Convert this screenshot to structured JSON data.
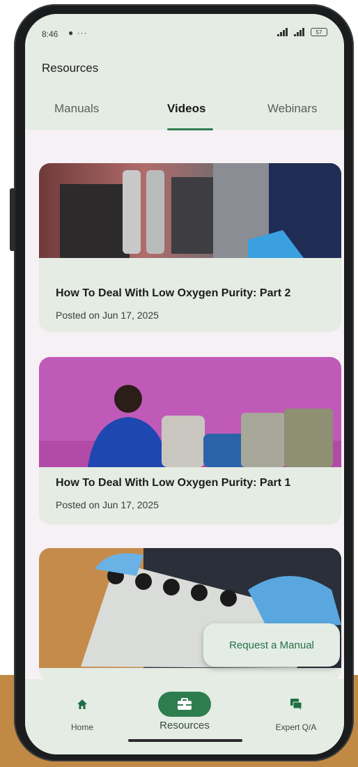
{
  "status_bar": {
    "time": "8:46",
    "battery": "57"
  },
  "header": {
    "title": "Resources"
  },
  "tabs": [
    {
      "label": "Manuals"
    },
    {
      "label": "Videos"
    },
    {
      "label": "Webinars"
    }
  ],
  "active_tab": "Videos",
  "videos": [
    {
      "title": "How To Deal With Low Oxygen Purity: Part 2",
      "date": "Posted on Jun 17, 2025"
    },
    {
      "title": "How To Deal With Low Oxygen Purity: Part 1",
      "date": "Posted on Jun 17, 2025"
    },
    {
      "title": "",
      "date": ""
    }
  ],
  "fab": {
    "label": "Request a Manual"
  },
  "bottom_nav": [
    {
      "label": "Home",
      "icon": "home-icon"
    },
    {
      "label": "Resources",
      "icon": "briefcase-icon"
    },
    {
      "label": "Expert Q/A",
      "icon": "chat-icon"
    }
  ],
  "colors": {
    "accent": "#2e7d4f",
    "surface": "#e4ece4",
    "background": "#f6f1f4",
    "frame_bg": "#c08a45"
  }
}
